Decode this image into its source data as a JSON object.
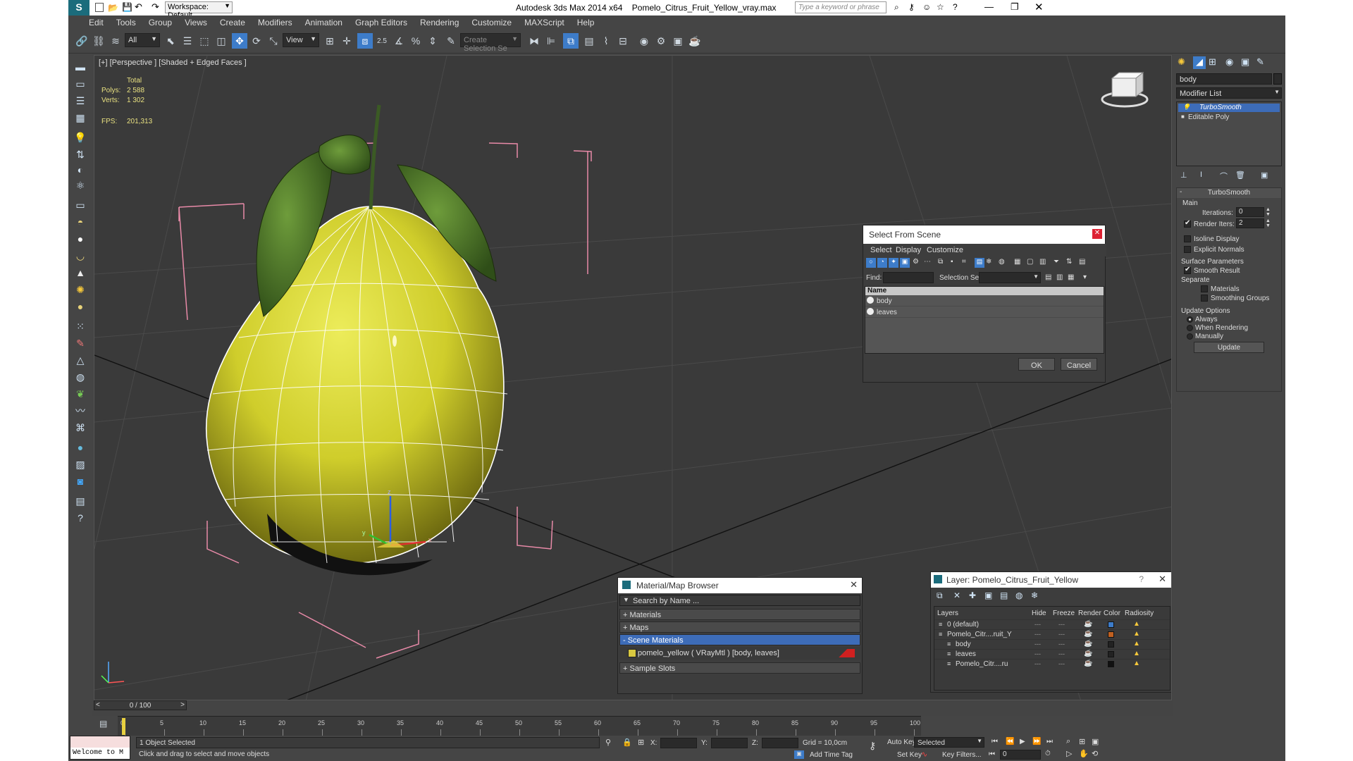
{
  "titlebar": {
    "workspace": "Workspace: Default",
    "app": "Autodesk 3ds Max  2014 x64",
    "file": "Pomelo_Citrus_Fruit_Yellow_vray.max",
    "search_placeholder": "Type a keyword or phrase"
  },
  "menus": [
    "Edit",
    "Tools",
    "Group",
    "Views",
    "Create",
    "Modifiers",
    "Animation",
    "Graph Editors",
    "Rendering",
    "Customize",
    "MAXScript",
    "Help"
  ],
  "toolbar": {
    "filter": "All",
    "ref_coord": "View",
    "snap_value": "2.5",
    "selection_set_placeholder": "Create Selection Se"
  },
  "viewport": {
    "label": "[+] [Perspective ] [Shaded + Edged Faces ]",
    "stats": {
      "total_label": "Total",
      "polys_label": "Polys:",
      "polys": "2 588",
      "verts_label": "Verts:",
      "verts": "1 302",
      "fps_label": "FPS:",
      "fps": "201,313"
    },
    "axis": {
      "x": "x",
      "y": "y",
      "z": "z"
    }
  },
  "command_panel": {
    "object_name": "body",
    "modifier_list": "Modifier List",
    "stack": [
      "TurboSmooth",
      "Editable Poly"
    ],
    "rollout_title": "TurboSmooth",
    "main_label": "Main",
    "iterations_label": "Iterations:",
    "iterations": "0",
    "render_iters_label": "Render Iters:",
    "render_iters": "2",
    "isoline": "Isoline Display",
    "explicit": "Explicit Normals",
    "surface_label": "Surface Parameters",
    "smooth_result": "Smooth Result",
    "separate_label": "Separate",
    "materials": "Materials",
    "smoothing_groups": "Smoothing Groups",
    "update_label": "Update Options",
    "always": "Always",
    "when_rendering": "When Rendering",
    "manually": "Manually",
    "update_btn": "Update"
  },
  "select_dialog": {
    "title": "Select From Scene",
    "menus": [
      "Select",
      "Display",
      "Customize"
    ],
    "find_label": "Find:",
    "selset_label": "Selection Set:",
    "col_name": "Name",
    "items": [
      "body",
      "leaves"
    ],
    "ok": "OK",
    "cancel": "Cancel"
  },
  "material_browser": {
    "title": "Material/Map Browser",
    "search_placeholder": "Search by Name ...",
    "groups": [
      "+ Materials",
      "+ Maps",
      "- Scene Materials"
    ],
    "material_item": "pomelo_yellow  ( VRayMtl ) [body, leaves]",
    "sample_slots": "+ Sample Slots"
  },
  "layer_dialog": {
    "title": "Layer: Pomelo_Citrus_Fruit_Yellow",
    "columns": [
      "Layers",
      "Hide",
      "Freeze",
      "Render",
      "Color",
      "Radiosity"
    ],
    "rows": [
      {
        "name": "0 (default)",
        "color": "#3d7cc9"
      },
      {
        "name": "Pomelo_Citr....ruit_Y",
        "color": "#c06020"
      },
      {
        "name": "body",
        "color": "#222222"
      },
      {
        "name": "leaves",
        "color": "#222222"
      },
      {
        "name": "Pomelo_Citr....ru",
        "color": "#111111"
      }
    ]
  },
  "timeline": {
    "frame": "0 / 100",
    "ticks": [
      "0",
      "5",
      "10",
      "15",
      "20",
      "25",
      "30",
      "35",
      "40",
      "45",
      "50",
      "55",
      "60",
      "65",
      "70",
      "75",
      "80",
      "85",
      "90",
      "95",
      "100"
    ]
  },
  "status": {
    "maxscript": "Welcome to M",
    "selected": "1 Object Selected",
    "prompt": "Click and drag to select and move objects",
    "x_label": "X:",
    "y_label": "Y:",
    "z_label": "Z:",
    "grid": "Grid = 10,0cm",
    "add_time_tag": "Add Time Tag",
    "auto_key": "Auto Key",
    "selected_combo": "Selected",
    "set_key": "Set Key",
    "key_filters": "Key Filters...",
    "frame_field": "0"
  }
}
